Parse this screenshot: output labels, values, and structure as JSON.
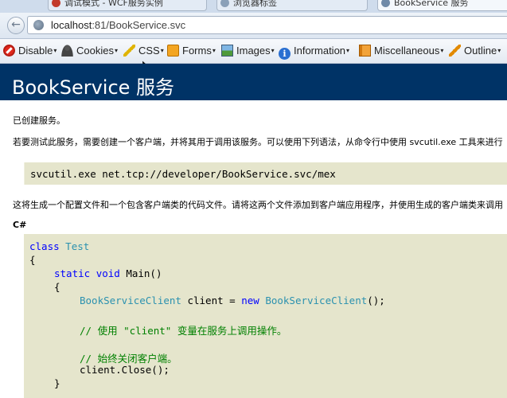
{
  "browser": {
    "tabs": [
      {
        "label": "调试模式 - WCF服务实例"
      },
      {
        "label": "浏览器标签"
      },
      {
        "label": "BookService 服务"
      }
    ],
    "url_host": "localhost",
    "url_rest": ":81/BookService.svc"
  },
  "devtoolbar": {
    "items": [
      {
        "label": "Disable",
        "icon": "disable-icon"
      },
      {
        "label": "Cookies",
        "icon": "cookies-icon"
      },
      {
        "label": "CSS",
        "icon": "css-icon"
      },
      {
        "label": "Forms",
        "icon": "forms-icon"
      },
      {
        "label": "Images",
        "icon": "images-icon"
      },
      {
        "label": "Information",
        "icon": "info-icon"
      },
      {
        "label": "Miscellaneous",
        "icon": "misc-icon"
      },
      {
        "label": "Outline",
        "icon": "outline-icon"
      }
    ]
  },
  "page": {
    "title": "BookService 服务",
    "created": "已创建服务。",
    "intro": "若要测试此服务，需要创建一个客户端，并将其用于调用该服务。可以使用下列语法，从命令行中使用 svcutil.exe 工具来进行",
    "command": "svcutil.exe net.tcp://developer/BookService.svc/mex",
    "generate_note": "这将生成一个配置文件和一个包含客户端类的代码文件。请将这两个文件添加到客户端应用程序，并使用生成的客户端类来调用",
    "language_heading": "C#",
    "code": {
      "l1_kw": "class",
      "l1_type": "Test",
      "l2": "{",
      "l3_kw1": "static",
      "l3_kw2": "void",
      "l3_rest": "Main()",
      "l4": "{",
      "l5_type1": "BookServiceClient",
      "l5_mid": "client = ",
      "l5_kw": "new",
      "l5_type2": "BookServiceClient",
      "l5_end": "();",
      "l6_comment": "// 使用 \"client\" 变量在服务上调用操作。",
      "l7_comment": "// 始终关闭客户端。",
      "l8": "client.Close();",
      "l9": "}"
    }
  }
}
